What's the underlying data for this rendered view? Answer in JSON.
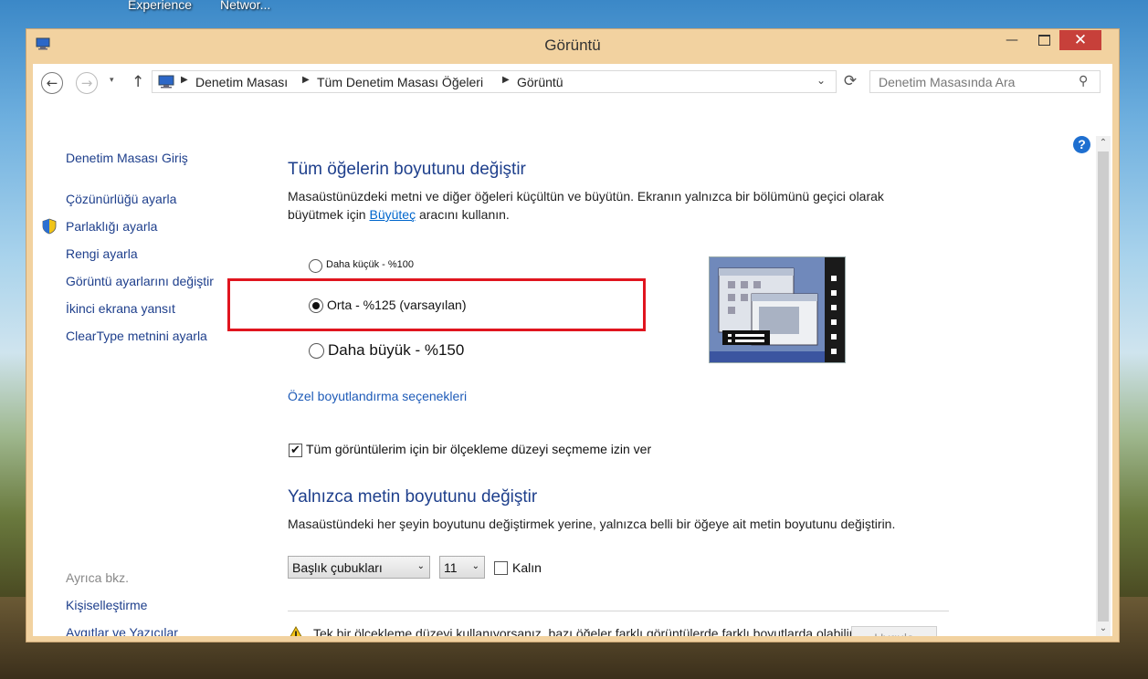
{
  "desktop": {
    "icons": [
      "Experience",
      "Networ..."
    ]
  },
  "window": {
    "title": "Görüntü"
  },
  "titlebar": {
    "minimize": "—",
    "close": "✕"
  },
  "nav": {
    "back": "←",
    "forward": "→",
    "recent": "▾",
    "up": "↑",
    "breadcrumbs": [
      "Denetim Masası",
      "Tüm Denetim Masası Öğeleri",
      "Görüntü"
    ],
    "separator": "▶",
    "address_dropdown": "⌄",
    "refresh": "⟳",
    "search_placeholder": "Denetim Masasında Ara",
    "search_icon": "⚲"
  },
  "sidebar": {
    "home": "Denetim Masası Giriş",
    "items": [
      "Çözünürlüğü ayarla",
      "Parlaklığı ayarla",
      "Rengi ayarla",
      "Görüntü ayarlarını değiştir",
      "İkinci ekrana yansıt",
      "ClearType metnini ayarla"
    ],
    "see_also_label": "Ayrıca bkz.",
    "see_also": [
      "Kişiselleştirme",
      "Aygıtlar ve Yazıcılar"
    ]
  },
  "section1": {
    "heading": "Tüm öğelerin boyutunu değiştir",
    "desc_line1": "Masaüstünüzdeki metni ve diğer öğeleri küçültün ve büyütün. Ekranın yalnızca bir bölümünü geçici olarak",
    "desc_line2_pre": "büyütmek için ",
    "desc_link": "Büyüteç",
    "desc_line2_post": " aracını kullanın.",
    "options": [
      {
        "label": "Daha küçük - %100",
        "selected": false
      },
      {
        "label": "Orta - %125 (varsayılan)",
        "selected": true
      },
      {
        "label": "Daha büyük - %150",
        "selected": false
      }
    ],
    "custom_link": "Özel boyutlandırma seçenekleri",
    "checkbox_label": "Tüm görüntülerim için bir ölçekleme düzeyi seçmeme izin ver",
    "checkbox_checked": true,
    "checkbox_mark": "✔"
  },
  "section2": {
    "heading": "Yalnızca metin boyutunu değiştir",
    "desc": "Masaüstündeki her şeyin boyutunu değiştirmek yerine, yalnızca belli bir öğeye ait metin boyutunu değiştirin.",
    "item_select": "Başlık çubukları",
    "size_select": "11",
    "select_arrow": "⌄",
    "bold_label": "Kalın",
    "bold_checked": false
  },
  "footer": {
    "warning_icon": "⚠",
    "warning": "Tek bir ölçekleme düzeyi kullanıyorsanız, bazı öğeler farklı görüntülerde farklı boyutlarda olabilir.",
    "apply": "Uygula"
  },
  "help": "?",
  "scroll": {
    "up": "⌃",
    "down": "⌄"
  },
  "colors": {
    "accent": "#1e3f8c",
    "link": "#0066cc",
    "highlight": "#e0151f",
    "close": "#c7403a"
  }
}
